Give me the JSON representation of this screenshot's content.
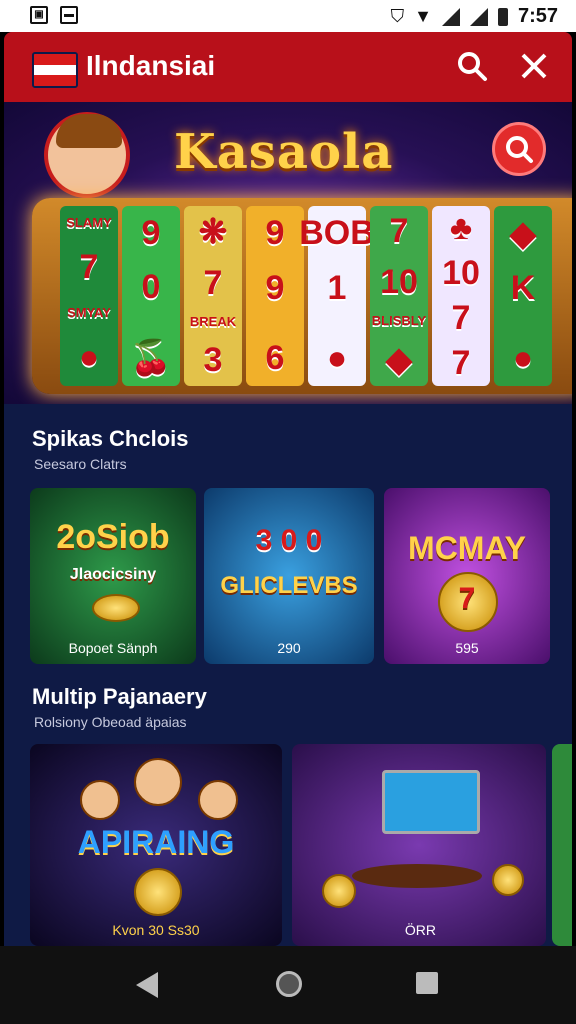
{
  "status": {
    "time": "7:57",
    "left_icons": [
      "image-icon",
      "sd-card-icon"
    ],
    "right_icons": [
      "shield-icon",
      "wifi-icon",
      "signal-icon",
      "signal-icon",
      "battery-icon"
    ]
  },
  "header": {
    "title": "Ilndansiai",
    "bg_color": "#b8101a"
  },
  "hero": {
    "title": "Kasaola",
    "reels": [
      {
        "symbols": [
          "SLAMY",
          "7",
          "SMYAY",
          "●"
        ],
        "color": "#1f8a3a"
      },
      {
        "symbols": [
          "9",
          "0",
          "",
          "🍒"
        ],
        "color": "#38b54a"
      },
      {
        "symbols": [
          "❋",
          "7",
          "BREAK",
          "3"
        ],
        "color": "#e3c24a"
      },
      {
        "symbols": [
          "9",
          "9",
          "",
          "6"
        ],
        "color": "#f1b02a"
      },
      {
        "symbols": [
          "BOB",
          "1",
          "",
          "●"
        ],
        "color": "#f4f2ff"
      },
      {
        "symbols": [
          "7",
          "10",
          "BLISBLY",
          "◆"
        ],
        "color": "#3fa84a"
      },
      {
        "symbols": [
          "♣",
          "10",
          "7",
          "7"
        ],
        "color": "#f0e7ff"
      },
      {
        "symbols": [
          "◆",
          "K",
          "",
          "●"
        ],
        "color": "#2e9a3e"
      }
    ]
  },
  "section1": {
    "title": "Spikas Chclois",
    "subtitle": "Seesaro Clatrs",
    "cards": [
      {
        "art_title": "2oSiob",
        "art_sub": "Jlaocicsiny",
        "label": "Bopoet Sänph",
        "bg": "#1e6b33"
      },
      {
        "art_title": "3 0 0",
        "art_sub": "GLICLEVBS",
        "label": "290",
        "bg": "#1b6fb0"
      },
      {
        "art_title": "MCMAY",
        "art_sub": "7",
        "label": "595",
        "bg": "#8a2fb8"
      }
    ]
  },
  "section2": {
    "title": "Multip Pajanaery",
    "subtitle": "Rolsiony Obeoad äpaias",
    "cards": [
      {
        "art_title": "APIRAING",
        "label": "Kvon 30 Ss30",
        "bg": "#1a1440"
      },
      {
        "art_title": "",
        "label": "ÖRR",
        "bg": "#5b2a8c"
      }
    ]
  },
  "nav": {
    "buttons": [
      "back",
      "home",
      "recents"
    ]
  }
}
